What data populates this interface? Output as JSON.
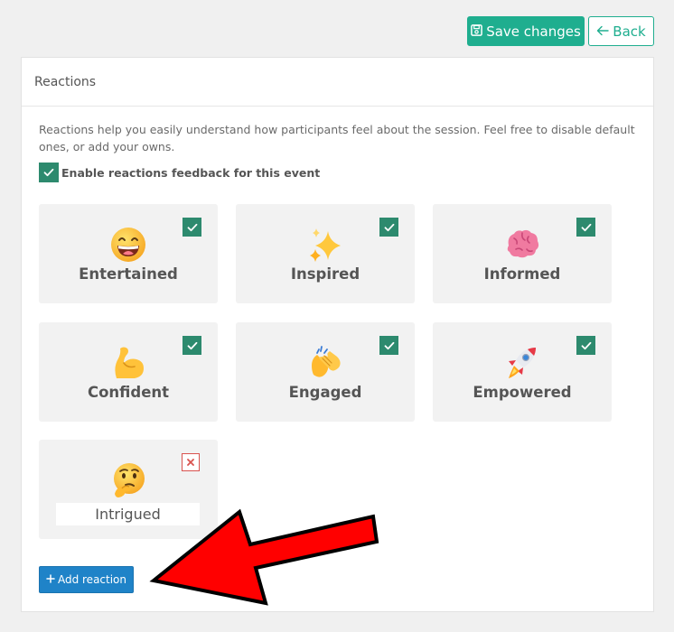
{
  "toolbar": {
    "save_label": "Save changes",
    "back_label": "Back",
    "save_icon": "floppy-disk-icon",
    "back_icon": "arrow-left-icon",
    "accent_color": "#1fae8f"
  },
  "panel": {
    "title": "Reactions",
    "description": "Reactions help you easily understand how participants feel about the session. Feel free to disable default ones, or add your owns.",
    "enable_label": "Enable reactions feedback for this event",
    "enable_checked": true
  },
  "reactions": [
    {
      "label": "Entertained",
      "emoji": "grinning-face-icon",
      "enabled": true
    },
    {
      "label": "Inspired",
      "emoji": "sparkles-icon",
      "enabled": true
    },
    {
      "label": "Informed",
      "emoji": "brain-icon",
      "enabled": true
    },
    {
      "label": "Confident",
      "emoji": "flexed-biceps-icon",
      "enabled": true
    },
    {
      "label": "Engaged",
      "emoji": "clapping-hands-icon",
      "enabled": true
    },
    {
      "label": "Empowered",
      "emoji": "rocket-icon",
      "enabled": true
    }
  ],
  "custom_reaction": {
    "value": "Intrigued",
    "emoji": "thinking-face-icon",
    "remove_icon": "close-icon"
  },
  "add_button": {
    "label": "Add reaction",
    "icon": "plus-icon",
    "color": "#1f83c8"
  },
  "annotation": {
    "icon": "red-arrow-icon",
    "color": "#ff0000"
  }
}
